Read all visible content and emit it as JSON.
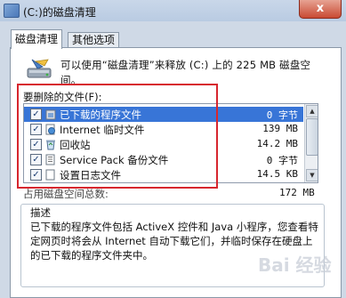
{
  "window": {
    "title": "(C:)的磁盘清理",
    "close_label": "x"
  },
  "tabs": [
    {
      "label": "磁盘清理",
      "active": true
    },
    {
      "label": "其他选项",
      "active": false
    }
  ],
  "summary": {
    "text": "可以使用“磁盘清理”来释放 (C:) 上的 225 MB 磁盘空间。"
  },
  "files_to_delete": {
    "label": "要删除的文件(F):",
    "items": [
      {
        "name": "已下载的程序文件",
        "size": "0 字节",
        "checked": true,
        "selected": true,
        "icon": "folder-icon"
      },
      {
        "name": "Internet 临时文件",
        "size": "139 MB",
        "checked": true,
        "selected": false,
        "icon": "internet-files-icon"
      },
      {
        "name": "回收站",
        "size": "14.2 MB",
        "checked": true,
        "selected": false,
        "icon": "recycle-bin-icon"
      },
      {
        "name": "Service Pack 备份文件",
        "size": "0 字节",
        "checked": true,
        "selected": false,
        "icon": "backup-files-icon"
      },
      {
        "name": "设置日志文件",
        "size": "14.5 KB",
        "checked": true,
        "selected": false,
        "icon": "log-file-icon"
      }
    ]
  },
  "total": {
    "label": "占用磁盘空间总数:",
    "value": "172 MB"
  },
  "description": {
    "title": "描述",
    "text": "已下载的程序文件包括 ActiveX 控件和 Java 小程序，您查看特定网页时将会从 Internet 自动下载它们，并临时保存在硬盘上的已下载的程序文件夹中。"
  },
  "watermark": "Bai 经验",
  "colors": {
    "highlight_box": "#d7262e",
    "selection": "#3875d7"
  }
}
